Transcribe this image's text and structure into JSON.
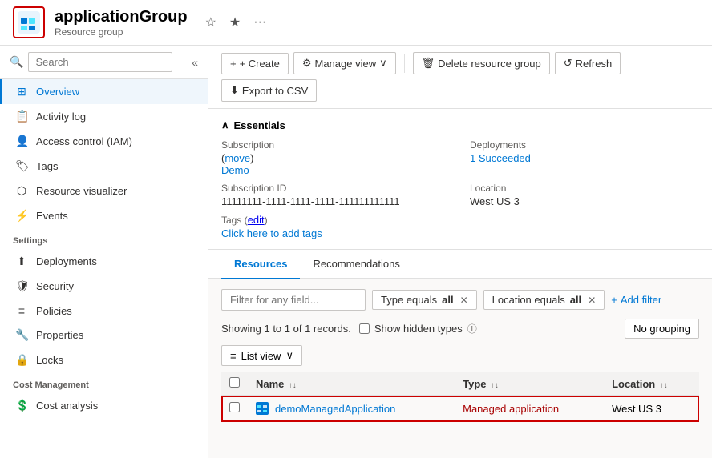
{
  "header": {
    "app_name": "applicationGroup",
    "app_subtitle": "Resource group",
    "star_icon": "☆",
    "star_filled_icon": "★",
    "more_icon": "···"
  },
  "toolbar": {
    "create_label": "+ Create",
    "manage_view_label": "Manage view",
    "delete_label": "Delete resource group",
    "refresh_label": "Refresh",
    "export_label": "Export to CSV"
  },
  "sidebar": {
    "search_placeholder": "Search",
    "items": [
      {
        "id": "overview",
        "label": "Overview",
        "icon": "⊞",
        "active": true
      },
      {
        "id": "activity-log",
        "label": "Activity log",
        "icon": "📋"
      },
      {
        "id": "access-control",
        "label": "Access control (IAM)",
        "icon": "👤"
      },
      {
        "id": "tags",
        "label": "Tags",
        "icon": "🏷"
      },
      {
        "id": "resource-visualizer",
        "label": "Resource visualizer",
        "icon": "⬡"
      },
      {
        "id": "events",
        "label": "Events",
        "icon": "⚡"
      }
    ],
    "settings_label": "Settings",
    "settings_items": [
      {
        "id": "deployments",
        "label": "Deployments",
        "icon": "⬆"
      },
      {
        "id": "security",
        "label": "Security",
        "icon": "🛡"
      },
      {
        "id": "policies",
        "label": "Policies",
        "icon": "≡"
      },
      {
        "id": "properties",
        "label": "Properties",
        "icon": "🔧"
      },
      {
        "id": "locks",
        "label": "Locks",
        "icon": "🔒"
      }
    ],
    "cost_label": "Cost Management",
    "cost_items": [
      {
        "id": "cost-analysis",
        "label": "Cost analysis",
        "icon": "💲"
      }
    ]
  },
  "essentials": {
    "section_label": "Essentials",
    "subscription_label": "Subscription",
    "subscription_move_link": "move",
    "subscription_value": "Demo",
    "subscription_id_label": "Subscription ID",
    "subscription_id_value": "11111111-1111-1111-1111-111111111111",
    "tags_label": "Tags",
    "tags_edit_link": "edit",
    "tags_add_link": "Click here to add tags",
    "deployments_label": "Deployments",
    "deployments_value": "1 Succeeded",
    "location_label": "Location",
    "location_value": "West US 3"
  },
  "tabs": [
    {
      "id": "resources",
      "label": "Resources",
      "active": true
    },
    {
      "id": "recommendations",
      "label": "Recommendations",
      "active": false
    }
  ],
  "resources": {
    "filter_placeholder": "Filter for any field...",
    "type_filter_label": "Type equals",
    "type_filter_value": "all",
    "location_filter_label": "Location equals",
    "location_filter_value": "all",
    "add_filter_label": "Add filter",
    "showing_label": "Showing 1 to 1 of 1 records.",
    "show_hidden_label": "Show hidden types",
    "no_grouping_label": "No grouping",
    "list_view_label": "List view",
    "columns": [
      {
        "id": "name",
        "label": "Name"
      },
      {
        "id": "type",
        "label": "Type"
      },
      {
        "id": "location",
        "label": "Location"
      }
    ],
    "rows": [
      {
        "id": "demoManagedApplication",
        "name": "demoManagedApplication",
        "type": "Managed application",
        "location": "West US 3",
        "highlighted": true
      }
    ]
  }
}
